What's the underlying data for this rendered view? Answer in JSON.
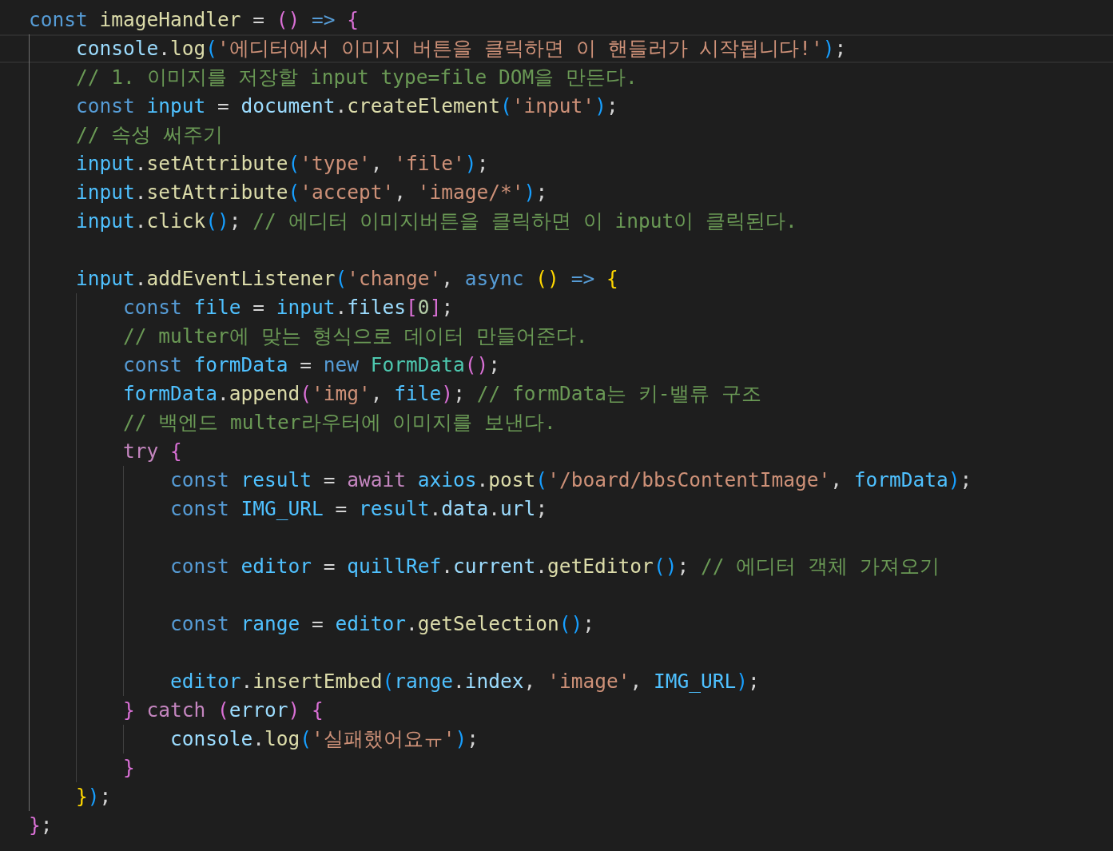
{
  "editor": {
    "lines": [
      {
        "current": false,
        "tokens": [
          {
            "text": "const ",
            "kind": "kw"
          },
          {
            "text": "imageHandler",
            "kind": "fn"
          },
          {
            "text": " = ",
            "kind": "p"
          },
          {
            "text": "() ",
            "kind": "b2"
          },
          {
            "text": "=> ",
            "kind": "kw"
          },
          {
            "text": "{",
            "kind": "b2"
          }
        ],
        "children": [
          {
            "current": true,
            "tokens": [
              {
                "text": "console",
                "kind": "var"
              },
              {
                "text": ".",
                "kind": "p"
              },
              {
                "text": "log",
                "kind": "fn"
              },
              {
                "text": "(",
                "kind": "b3"
              },
              {
                "text": "'에디터에서 이미지 버튼을 클릭하면 이 핸들러가 시작됩니다!'",
                "kind": "str"
              },
              {
                "text": ")",
                "kind": "b3"
              },
              {
                "text": ";",
                "kind": "p"
              }
            ]
          },
          {
            "current": false,
            "tokens": [
              {
                "text": "// 1. 이미지를 저장할 input type=file DOM을 만든다.",
                "kind": "cm"
              }
            ]
          },
          {
            "current": false,
            "tokens": [
              {
                "text": "const ",
                "kind": "kw"
              },
              {
                "text": "input",
                "kind": "const"
              },
              {
                "text": " = ",
                "kind": "p"
              },
              {
                "text": "document",
                "kind": "var"
              },
              {
                "text": ".",
                "kind": "p"
              },
              {
                "text": "createElement",
                "kind": "fn"
              },
              {
                "text": "(",
                "kind": "b3"
              },
              {
                "text": "'input'",
                "kind": "str"
              },
              {
                "text": ")",
                "kind": "b3"
              },
              {
                "text": ";",
                "kind": "p"
              }
            ]
          },
          {
            "current": false,
            "tokens": [
              {
                "text": "// 속성 써주기",
                "kind": "cm"
              }
            ]
          },
          {
            "current": false,
            "tokens": [
              {
                "text": "input",
                "kind": "const"
              },
              {
                "text": ".",
                "kind": "p"
              },
              {
                "text": "setAttribute",
                "kind": "fn"
              },
              {
                "text": "(",
                "kind": "b3"
              },
              {
                "text": "'type'",
                "kind": "str"
              },
              {
                "text": ", ",
                "kind": "p"
              },
              {
                "text": "'file'",
                "kind": "str"
              },
              {
                "text": ")",
                "kind": "b3"
              },
              {
                "text": ";",
                "kind": "p"
              }
            ]
          },
          {
            "current": false,
            "tokens": [
              {
                "text": "input",
                "kind": "const"
              },
              {
                "text": ".",
                "kind": "p"
              },
              {
                "text": "setAttribute",
                "kind": "fn"
              },
              {
                "text": "(",
                "kind": "b3"
              },
              {
                "text": "'accept'",
                "kind": "str"
              },
              {
                "text": ", ",
                "kind": "p"
              },
              {
                "text": "'image/*'",
                "kind": "str"
              },
              {
                "text": ")",
                "kind": "b3"
              },
              {
                "text": ";",
                "kind": "p"
              }
            ]
          },
          {
            "current": false,
            "tokens": [
              {
                "text": "input",
                "kind": "const"
              },
              {
                "text": ".",
                "kind": "p"
              },
              {
                "text": "click",
                "kind": "fn"
              },
              {
                "text": "()",
                "kind": "b3"
              },
              {
                "text": "; ",
                "kind": "p"
              },
              {
                "text": "// 에디터 이미지버튼을 클릭하면 이 input이 클릭된다.",
                "kind": "cm"
              }
            ]
          },
          {
            "current": false
          },
          {
            "current": false,
            "tokens": [
              {
                "text": "input",
                "kind": "const"
              },
              {
                "text": ".",
                "kind": "p"
              },
              {
                "text": "addEventListener",
                "kind": "fn"
              },
              {
                "text": "(",
                "kind": "b3"
              },
              {
                "text": "'change'",
                "kind": "str"
              },
              {
                "text": ", ",
                "kind": "p"
              },
              {
                "text": "async ",
                "kind": "kw"
              },
              {
                "text": "() ",
                "kind": "b1"
              },
              {
                "text": "=> ",
                "kind": "kw"
              },
              {
                "text": "{",
                "kind": "b1"
              }
            ],
            "children": [
              {
                "current": false,
                "tokens": [
                  {
                    "text": "const ",
                    "kind": "kw"
                  },
                  {
                    "text": "file",
                    "kind": "const"
                  },
                  {
                    "text": " = ",
                    "kind": "p"
                  },
                  {
                    "text": "input",
                    "kind": "const"
                  },
                  {
                    "text": ".",
                    "kind": "p"
                  },
                  {
                    "text": "files",
                    "kind": "var"
                  },
                  {
                    "text": "[",
                    "kind": "b2"
                  },
                  {
                    "text": "0",
                    "kind": "num"
                  },
                  {
                    "text": "]",
                    "kind": "b2"
                  },
                  {
                    "text": ";",
                    "kind": "p"
                  }
                ]
              },
              {
                "current": false,
                "tokens": [
                  {
                    "text": "// multer에 맞는 형식으로 데이터 만들어준다.",
                    "kind": "cm"
                  }
                ]
              },
              {
                "current": false,
                "tokens": [
                  {
                    "text": "const ",
                    "kind": "kw"
                  },
                  {
                    "text": "formData",
                    "kind": "const"
                  },
                  {
                    "text": " = ",
                    "kind": "p"
                  },
                  {
                    "text": "new ",
                    "kind": "kw"
                  },
                  {
                    "text": "FormData",
                    "kind": "type"
                  },
                  {
                    "text": "()",
                    "kind": "b2"
                  },
                  {
                    "text": ";",
                    "kind": "p"
                  }
                ]
              },
              {
                "current": false,
                "tokens": [
                  {
                    "text": "formData",
                    "kind": "const"
                  },
                  {
                    "text": ".",
                    "kind": "p"
                  },
                  {
                    "text": "append",
                    "kind": "fn"
                  },
                  {
                    "text": "(",
                    "kind": "b2"
                  },
                  {
                    "text": "'img'",
                    "kind": "str"
                  },
                  {
                    "text": ", ",
                    "kind": "p"
                  },
                  {
                    "text": "file",
                    "kind": "const"
                  },
                  {
                    "text": ")",
                    "kind": "b2"
                  },
                  {
                    "text": "; ",
                    "kind": "p"
                  },
                  {
                    "text": "// formData는 키-밸류 구조",
                    "kind": "cm"
                  }
                ]
              },
              {
                "current": false,
                "tokens": [
                  {
                    "text": "// 백엔드 multer라우터에 이미지를 보낸다.",
                    "kind": "cm"
                  }
                ]
              },
              {
                "current": false,
                "tokens": [
                  {
                    "text": "try ",
                    "kind": "ctrl"
                  },
                  {
                    "text": "{",
                    "kind": "b2"
                  }
                ],
                "children": [
                  {
                    "current": false,
                    "tokens": [
                      {
                        "text": "const ",
                        "kind": "kw"
                      },
                      {
                        "text": "result",
                        "kind": "const"
                      },
                      {
                        "text": " = ",
                        "kind": "p"
                      },
                      {
                        "text": "await ",
                        "kind": "ctrl"
                      },
                      {
                        "text": "axios",
                        "kind": "const"
                      },
                      {
                        "text": ".",
                        "kind": "p"
                      },
                      {
                        "text": "post",
                        "kind": "fn"
                      },
                      {
                        "text": "(",
                        "kind": "b3"
                      },
                      {
                        "text": "'/board/bbsContentImage'",
                        "kind": "str"
                      },
                      {
                        "text": ", ",
                        "kind": "p"
                      },
                      {
                        "text": "formData",
                        "kind": "const"
                      },
                      {
                        "text": ")",
                        "kind": "b3"
                      },
                      {
                        "text": ";",
                        "kind": "p"
                      }
                    ]
                  },
                  {
                    "current": false,
                    "tokens": [
                      {
                        "text": "const ",
                        "kind": "kw"
                      },
                      {
                        "text": "IMG_URL",
                        "kind": "const"
                      },
                      {
                        "text": " = ",
                        "kind": "p"
                      },
                      {
                        "text": "result",
                        "kind": "const"
                      },
                      {
                        "text": ".",
                        "kind": "p"
                      },
                      {
                        "text": "data",
                        "kind": "var"
                      },
                      {
                        "text": ".",
                        "kind": "p"
                      },
                      {
                        "text": "url",
                        "kind": "var"
                      },
                      {
                        "text": ";",
                        "kind": "p"
                      }
                    ]
                  },
                  {
                    "current": false
                  },
                  {
                    "current": false,
                    "tokens": [
                      {
                        "text": "const ",
                        "kind": "kw"
                      },
                      {
                        "text": "editor",
                        "kind": "const"
                      },
                      {
                        "text": " = ",
                        "kind": "p"
                      },
                      {
                        "text": "quillRef",
                        "kind": "const"
                      },
                      {
                        "text": ".",
                        "kind": "p"
                      },
                      {
                        "text": "current",
                        "kind": "var"
                      },
                      {
                        "text": ".",
                        "kind": "p"
                      },
                      {
                        "text": "getEditor",
                        "kind": "fn"
                      },
                      {
                        "text": "()",
                        "kind": "b3"
                      },
                      {
                        "text": "; ",
                        "kind": "p"
                      },
                      {
                        "text": "// 에디터 객체 가져오기",
                        "kind": "cm"
                      }
                    ]
                  },
                  {
                    "current": false
                  },
                  {
                    "current": false,
                    "tokens": [
                      {
                        "text": "const ",
                        "kind": "kw"
                      },
                      {
                        "text": "range",
                        "kind": "const"
                      },
                      {
                        "text": " = ",
                        "kind": "p"
                      },
                      {
                        "text": "editor",
                        "kind": "const"
                      },
                      {
                        "text": ".",
                        "kind": "p"
                      },
                      {
                        "text": "getSelection",
                        "kind": "fn"
                      },
                      {
                        "text": "()",
                        "kind": "b3"
                      },
                      {
                        "text": ";",
                        "kind": "p"
                      }
                    ]
                  },
                  {
                    "current": false
                  },
                  {
                    "current": false,
                    "tokens": [
                      {
                        "text": "editor",
                        "kind": "const"
                      },
                      {
                        "text": ".",
                        "kind": "p"
                      },
                      {
                        "text": "insertEmbed",
                        "kind": "fn"
                      },
                      {
                        "text": "(",
                        "kind": "b3"
                      },
                      {
                        "text": "range",
                        "kind": "const"
                      },
                      {
                        "text": ".",
                        "kind": "p"
                      },
                      {
                        "text": "index",
                        "kind": "var"
                      },
                      {
                        "text": ", ",
                        "kind": "p"
                      },
                      {
                        "text": "'image'",
                        "kind": "str"
                      },
                      {
                        "text": ", ",
                        "kind": "p"
                      },
                      {
                        "text": "IMG_URL",
                        "kind": "const"
                      },
                      {
                        "text": ")",
                        "kind": "b3"
                      },
                      {
                        "text": ";",
                        "kind": "p"
                      }
                    ]
                  }
                ]
              },
              {
                "current": false,
                "tokens": [
                  {
                    "text": "} ",
                    "kind": "b2"
                  },
                  {
                    "text": "catch ",
                    "kind": "ctrl"
                  },
                  {
                    "text": "(",
                    "kind": "b2"
                  },
                  {
                    "text": "error",
                    "kind": "var"
                  },
                  {
                    "text": ") ",
                    "kind": "b2"
                  },
                  {
                    "text": "{",
                    "kind": "b2"
                  }
                ],
                "children": [
                  {
                    "current": false,
                    "tokens": [
                      {
                        "text": "console",
                        "kind": "var"
                      },
                      {
                        "text": ".",
                        "kind": "p"
                      },
                      {
                        "text": "log",
                        "kind": "fn"
                      },
                      {
                        "text": "(",
                        "kind": "b3"
                      },
                      {
                        "text": "'실패했어요ㅠ'",
                        "kind": "str"
                      },
                      {
                        "text": ")",
                        "kind": "b3"
                      },
                      {
                        "text": ";",
                        "kind": "p"
                      }
                    ]
                  }
                ]
              },
              {
                "current": false,
                "tokens": [
                  {
                    "text": "}",
                    "kind": "b2"
                  }
                ]
              }
            ]
          },
          {
            "current": false,
            "tokens": [
              {
                "text": "}",
                "kind": "b1"
              },
              {
                "text": ")",
                "kind": "b3"
              },
              {
                "text": ";",
                "kind": "p"
              }
            ]
          }
        ]
      },
      {
        "current": false,
        "tokens": [
          {
            "text": "}",
            "kind": "b2"
          },
          {
            "text": ";",
            "kind": "p"
          }
        ]
      }
    ]
  }
}
